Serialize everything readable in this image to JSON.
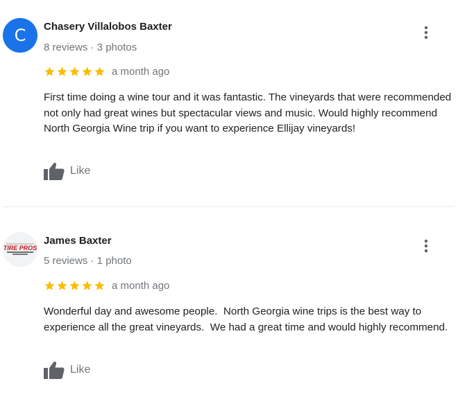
{
  "reviews": [
    {
      "avatar_letter": "C",
      "avatar_color": "#1a73e8",
      "name": "Chasery Villalobos Baxter",
      "meta": "8 reviews · 3 photos",
      "rating": 5,
      "date": "a month ago",
      "text": "First time doing a wine tour and it was fantastic. The vineyards that were recommended not only had great wines but spectacular views and music. Would highly recommend North Georgia Wine trip if you want to experience Ellijay vineyards!",
      "like_label": "Like",
      "menu_icon": "more-vert-icon",
      "like_icon": "thumbs-up-icon"
    },
    {
      "avatar_logo_text": "TIRE PROS",
      "name": "James Baxter",
      "meta": "5 reviews · 1 photo",
      "rating": 5,
      "date": "a month ago",
      "text": "Wonderful day and awesome people.  North Georgia wine trips is the best way to experience all the great vineyards.  We had a great time and would highly recommend.",
      "like_label": "Like",
      "menu_icon": "more-vert-icon",
      "like_icon": "thumbs-up-icon"
    }
  ],
  "colors": {
    "star": "#fbbc04",
    "secondary_text": "#70757a",
    "icon": "#5f6368",
    "divider": "#e8eaed"
  }
}
